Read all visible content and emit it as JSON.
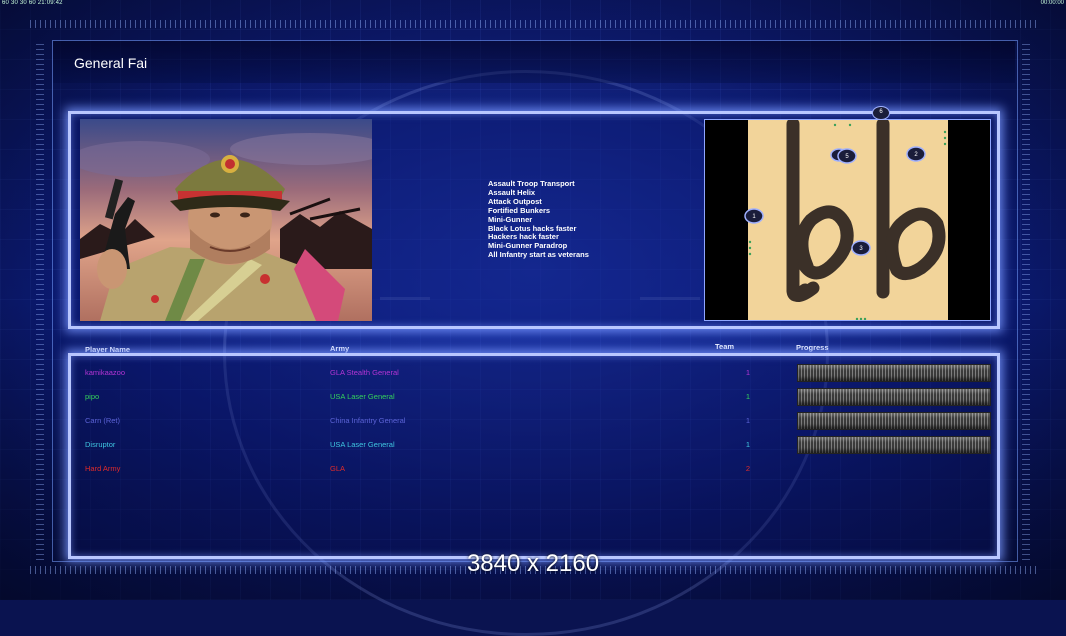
{
  "hud": {
    "top_left": "60 30 30 60 21:09:42",
    "top_right": "00:00:00"
  },
  "header": {
    "title": "General Fai"
  },
  "features": [
    "Assault Troop Transport",
    "Assault Helix",
    "Attack Outpost",
    "Fortified Bunkers",
    "Mini-Gunner",
    "Black Lotus hacks faster",
    "Hackers hack faster",
    "Mini-Gunner Paradrop",
    "All Infantry start as veterans"
  ],
  "minimap": {
    "start_markers": [
      "1",
      "2",
      "3",
      "4",
      "5",
      "6"
    ]
  },
  "table": {
    "headers": {
      "player_name": "Player Name",
      "army": "Army",
      "team": "Team",
      "progress": "Progress"
    },
    "rows": [
      {
        "name": "kamikaazoo",
        "army": "GLA Stealth General",
        "team": "1",
        "color": "#b534d4",
        "has_progress": true
      },
      {
        "name": "pipo",
        "army": "USA Laser General",
        "team": "1",
        "color": "#34d25c",
        "has_progress": true
      },
      {
        "name": "Carn (Ret)",
        "army": "China Infantry General",
        "team": "1",
        "color": "#5c63d6",
        "has_progress": true
      },
      {
        "name": "Disruptor",
        "army": "USA Laser General",
        "team": "1",
        "color": "#3fc6e0",
        "has_progress": true
      },
      {
        "name": "Hard Army",
        "army": "GLA",
        "team": "2",
        "color": "#e02b2b",
        "has_progress": false
      }
    ]
  },
  "resolution_label": "3840 x 2160"
}
